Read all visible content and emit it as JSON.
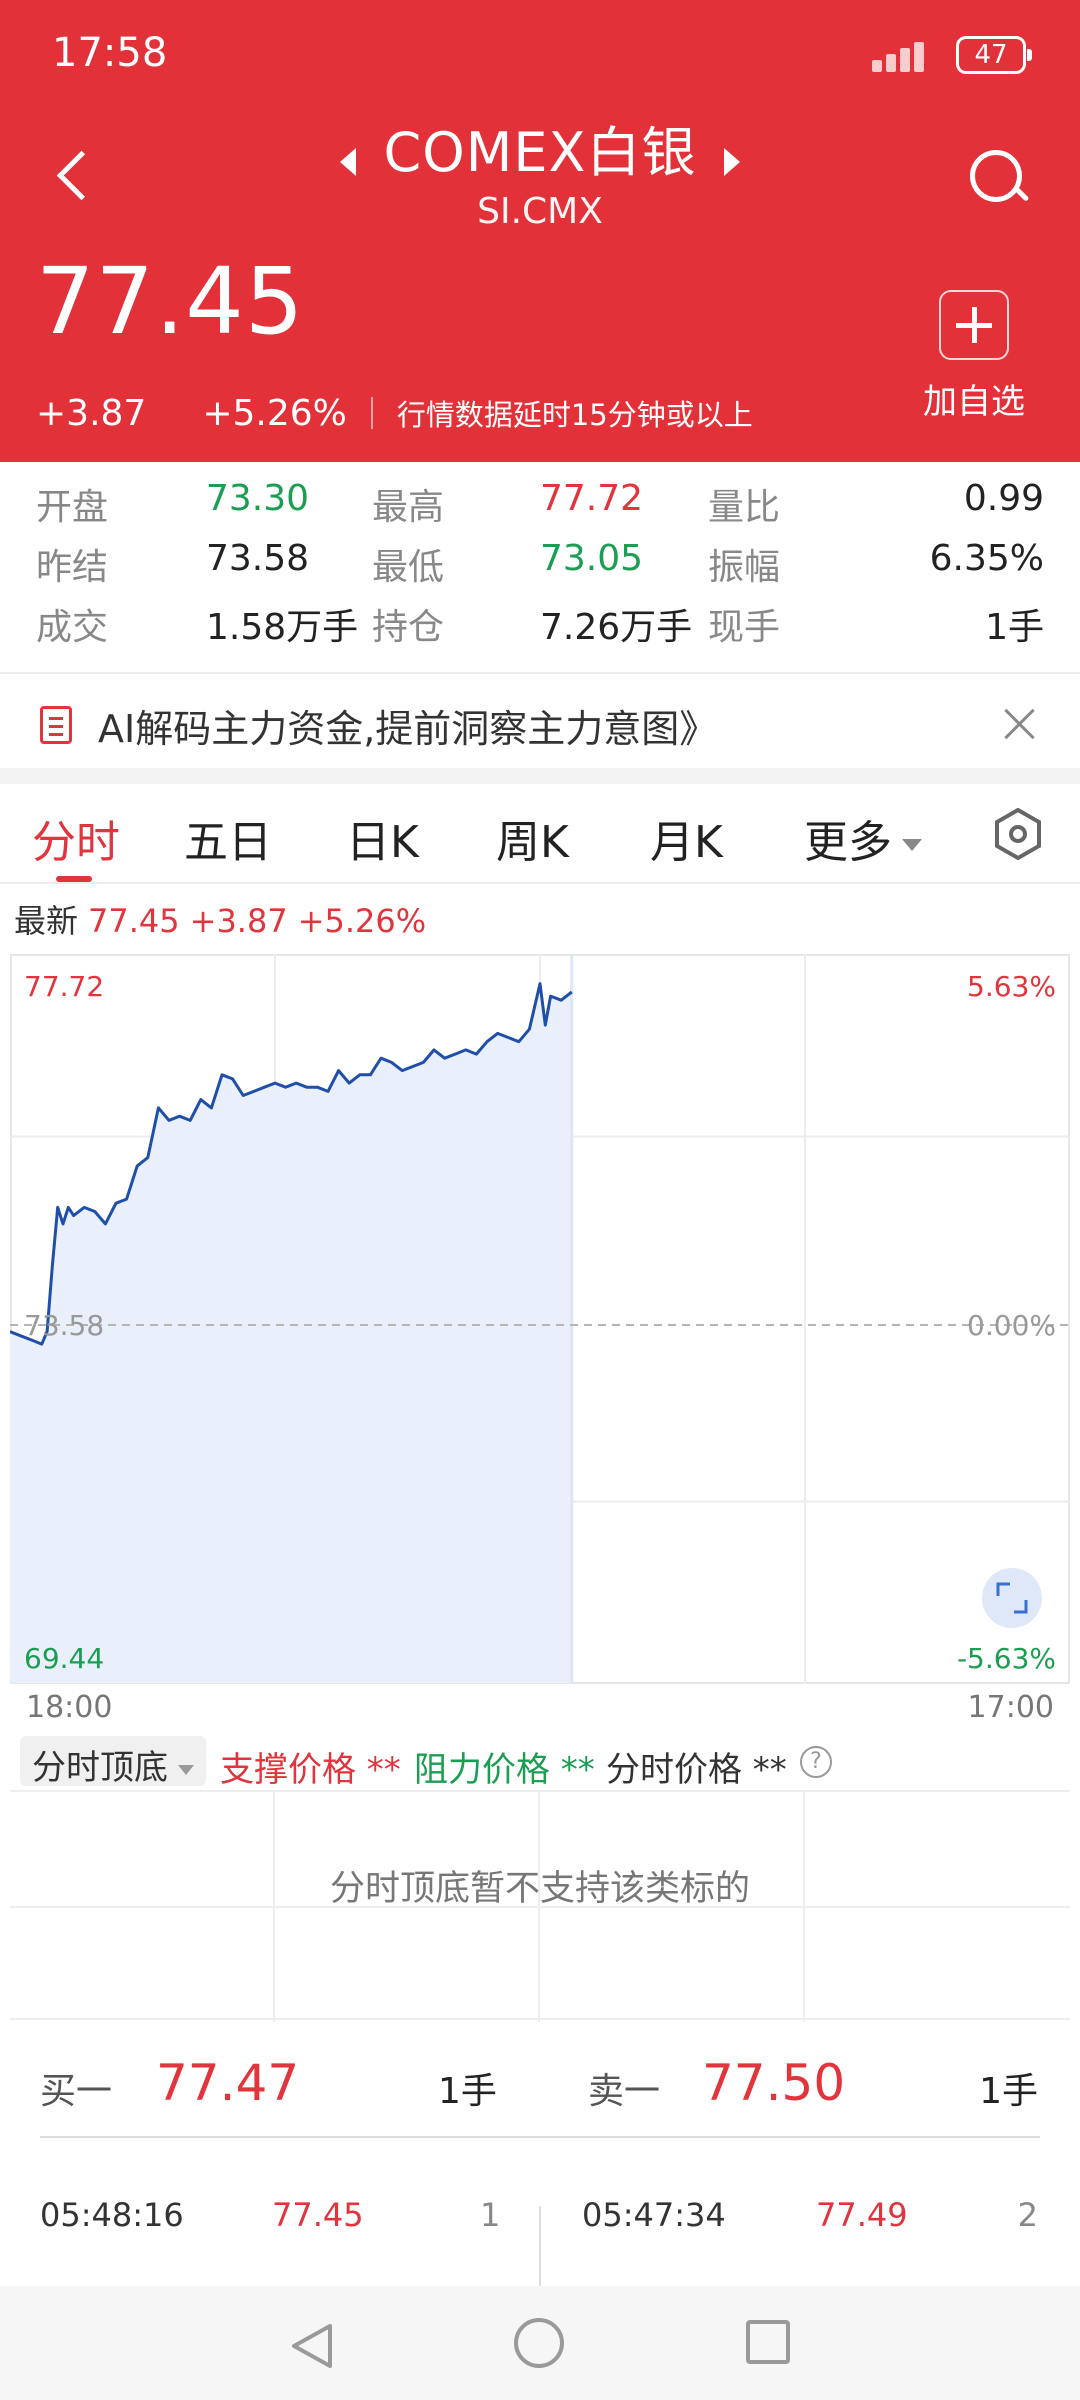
{
  "status": {
    "time": "17:58",
    "battery": "47"
  },
  "header": {
    "title": "COMEX白银",
    "subtitle": "SI.CMX",
    "price": "77.45",
    "change": "+3.87",
    "change_pct": "+5.26%",
    "delay_note": "行情数据延时15分钟或以上",
    "add_label": "加自选"
  },
  "stats": [
    {
      "l1": "开盘",
      "v1": "73.30",
      "l2": "最高",
      "v2": "77.72",
      "l3": "量比",
      "v3": "0.99"
    },
    {
      "l1": "昨结",
      "v1": "73.58",
      "l2": "最低",
      "v2": "73.05",
      "l3": "振幅",
      "v3": "6.35%"
    },
    {
      "l1": "成交",
      "v1": "1.58万手",
      "l2": "持仓",
      "v2": "7.26万手",
      "l3": "现手",
      "v3": "1手"
    }
  ],
  "banner": {
    "text": "AI解码主力资金,提前洞察主力意图》"
  },
  "tabs": [
    "分时",
    "五日",
    "日K",
    "周K",
    "月K",
    "更多"
  ],
  "latest": {
    "label": "最新",
    "price": "77.45",
    "change": "+3.87",
    "pct": "+5.26%"
  },
  "chart_data": {
    "type": "line",
    "y_labels_left": {
      "top": "77.72",
      "mid": "73.58",
      "bottom": "69.44"
    },
    "y_labels_right": {
      "top": "5.63%",
      "mid": "0.00%",
      "bottom": "-5.63%"
    },
    "x_labels": [
      "18:00",
      "17:00"
    ],
    "ylim": [
      69.44,
      77.72
    ],
    "reference": 73.58,
    "grid": true,
    "colors": {
      "line": "#1f4fa8",
      "fill": "#e9f0fb"
    },
    "series": [
      {
        "x": [
          0,
          0.01,
          0.02,
          0.03,
          0.035,
          0.04,
          0.045,
          0.05,
          0.055,
          0.06,
          0.07,
          0.08,
          0.09,
          0.1,
          0.11,
          0.12,
          0.13,
          0.14,
          0.15,
          0.16,
          0.17,
          0.18,
          0.19,
          0.2,
          0.21,
          0.22,
          0.23,
          0.24,
          0.25,
          0.26,
          0.27,
          0.28,
          0.29,
          0.3,
          0.31,
          0.32,
          0.33,
          0.34,
          0.35,
          0.36,
          0.37,
          0.38,
          0.39,
          0.4,
          0.41,
          0.42,
          0.43,
          0.44,
          0.45,
          0.46,
          0.47,
          0.48,
          0.49,
          0.5,
          0.505,
          0.51,
          0.52,
          0.53
        ],
        "y": [
          73.5,
          73.45,
          73.4,
          73.35,
          73.5,
          74.3,
          75.0,
          74.8,
          75.0,
          74.9,
          75.0,
          74.95,
          74.8,
          75.05,
          75.1,
          75.5,
          75.6,
          76.2,
          76.05,
          76.1,
          76.05,
          76.3,
          76.2,
          76.6,
          76.55,
          76.35,
          76.4,
          76.45,
          76.5,
          76.45,
          76.5,
          76.45,
          76.45,
          76.4,
          76.65,
          76.5,
          76.6,
          76.6,
          76.8,
          76.75,
          76.65,
          76.7,
          76.75,
          76.9,
          76.8,
          76.85,
          76.9,
          76.85,
          77.0,
          77.1,
          77.05,
          77.0,
          77.15,
          77.7,
          77.2,
          77.55,
          77.5,
          77.6
        ]
      }
    ],
    "fullscreen_icon": "expand-icon"
  },
  "indicator": {
    "select": "分时顶底",
    "support": "支撑价格 **",
    "resist": "阻力价格 **",
    "price": "分时价格 **",
    "help": "?",
    "message": "分时顶底暂不支持该类标的"
  },
  "orderbook": {
    "buy_label": "买一",
    "buy_price": "77.47",
    "buy_qty": "1手",
    "sell_label": "卖一",
    "sell_price": "77.50",
    "sell_qty": "1手"
  },
  "trades": [
    {
      "time": "05:48:16",
      "price": "77.45",
      "qty": "1"
    },
    {
      "time": "05:47:34",
      "price": "77.49",
      "qty": "2"
    }
  ]
}
